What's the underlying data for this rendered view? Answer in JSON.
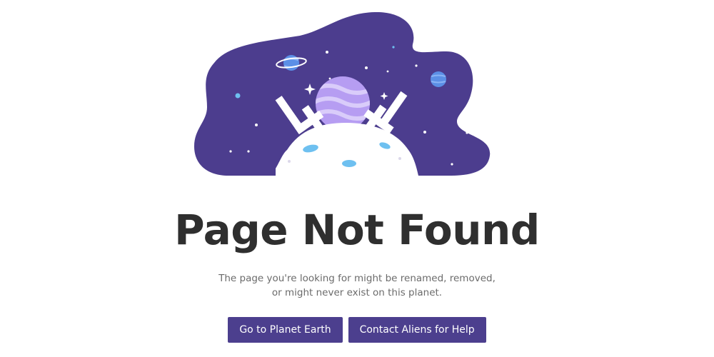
{
  "illustration": {
    "label": "404",
    "colors": {
      "space": "#4c3d8e",
      "planet": "#b69df2",
      "stars": "#ffffff",
      "accent_blue": "#5b8fe6"
    }
  },
  "heading": {
    "title": "Page Not Found"
  },
  "message": {
    "line1": "The page you're looking for might be renamed, removed,",
    "line2": "or might never exist on this planet."
  },
  "actions": {
    "home_label": "Go to Planet Earth",
    "help_label": "Contact Aliens for Help"
  },
  "theme": {
    "button_bg": "#4c3f8e",
    "title_color": "#2f2f2f",
    "text_color": "#6b6b6b"
  }
}
